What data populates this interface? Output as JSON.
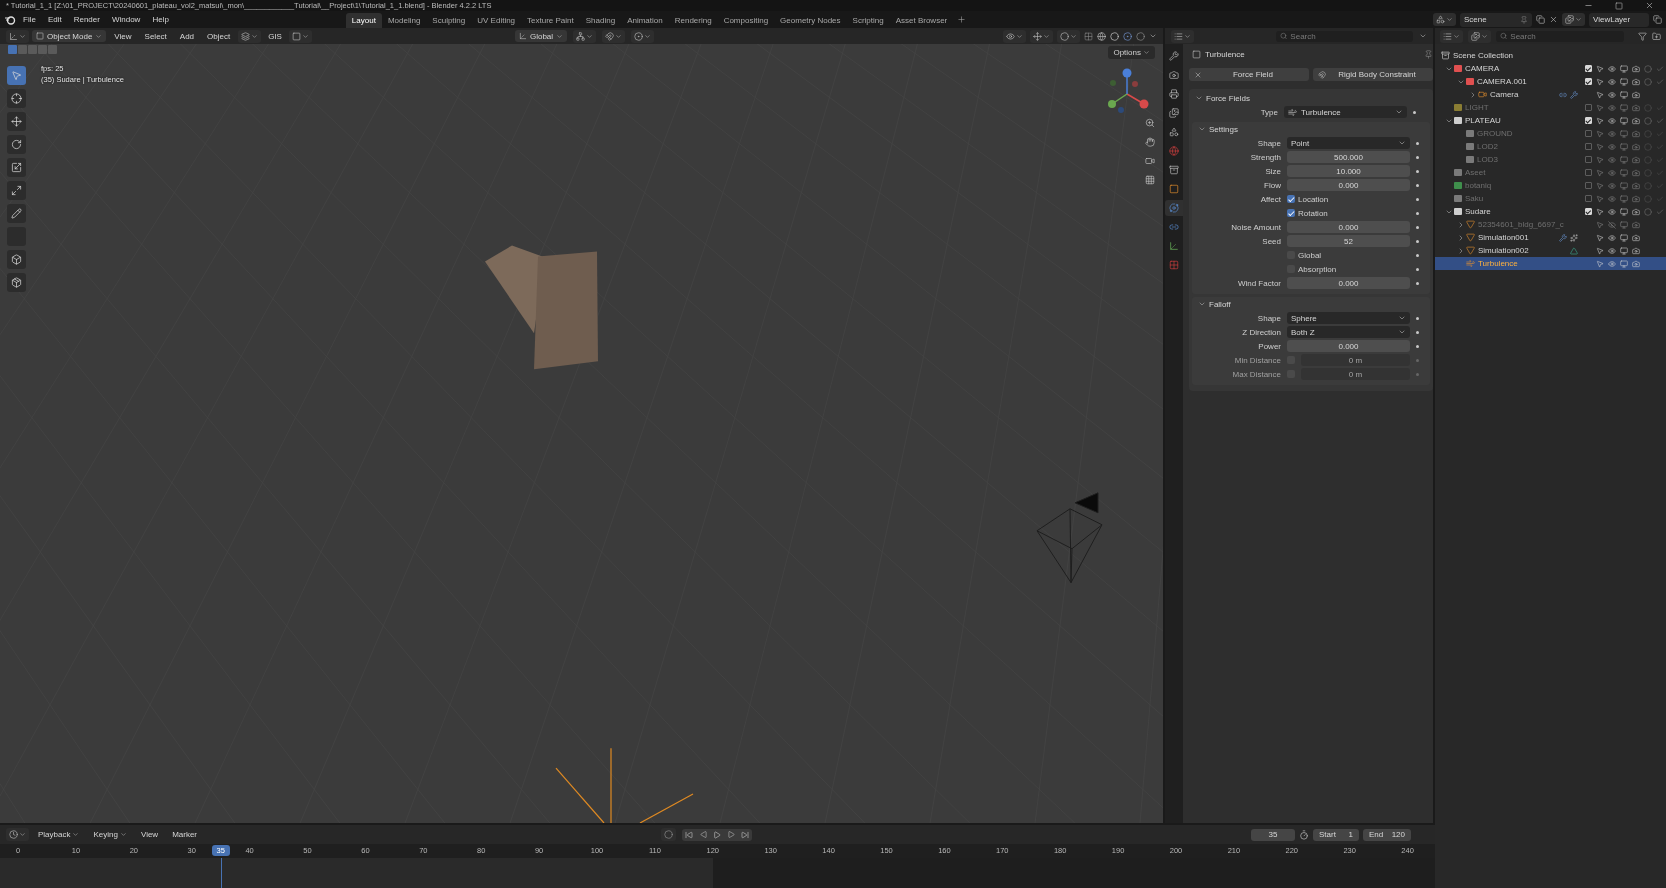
{
  "window": {
    "title": "* Tutorial_1_1 [Z:\\01_PROJECT\\20240601_plateau_vol2_matsui\\_mon\\____________Tutorial\\__Project\\1\\Tutorial_1_1.blend] - Blender 4.2.2 LTS"
  },
  "topbar": {
    "menus": [
      "File",
      "Edit",
      "Render",
      "Window",
      "Help"
    ],
    "workspaces": [
      {
        "label": "Layout",
        "selected": true
      },
      {
        "label": "Modeling",
        "selected": false
      },
      {
        "label": "Sculpting",
        "selected": false
      },
      {
        "label": "UV Editing",
        "selected": false
      },
      {
        "label": "Texture Paint",
        "selected": false
      },
      {
        "label": "Shading",
        "selected": false
      },
      {
        "label": "Animation",
        "selected": false
      },
      {
        "label": "Rendering",
        "selected": false
      },
      {
        "label": "Compositing",
        "selected": false
      },
      {
        "label": "Geometry Nodes",
        "selected": false
      },
      {
        "label": "Scripting",
        "selected": false
      },
      {
        "label": "Asset Browser",
        "selected": false
      }
    ],
    "scene": "Scene",
    "view_layer": "ViewLayer"
  },
  "viewport": {
    "mode": "Object Mode",
    "menus": [
      "View",
      "Select",
      "Add",
      "Object"
    ],
    "addon": "GIS",
    "orientation": "Global",
    "options": "Options",
    "overlay_lines": [
      "fps: 25",
      "(35) Sudare | Turbulence"
    ]
  },
  "properties": {
    "search": {
      "placeholder": "Search"
    },
    "tabs": [
      {
        "kind": "tool",
        "selected": false
      },
      {
        "kind": "render",
        "selected": false
      },
      {
        "kind": "output",
        "selected": false
      },
      {
        "kind": "view_layer",
        "selected": false
      },
      {
        "kind": "scene",
        "selected": false
      },
      {
        "kind": "world",
        "selected": false
      },
      {
        "kind": "collection",
        "selected": false
      },
      {
        "kind": "object",
        "selected": false
      },
      {
        "kind": "physics",
        "selected": true
      },
      {
        "kind": "constraints",
        "selected": false
      },
      {
        "kind": "data",
        "selected": false
      },
      {
        "kind": "texture",
        "selected": false
      }
    ],
    "object": "Turbulence",
    "buttons": [
      {
        "label": "Force Field",
        "kind": "remove"
      },
      {
        "label": "Rigid Body Constraint",
        "kind": "add"
      }
    ],
    "panel": {
      "title": "Force Fields",
      "expanded": true,
      "rows": [
        {
          "kind": "dropdown",
          "label": "Type",
          "value": "Turbulence",
          "with_icon": true
        }
      ],
      "subpanels": [
        {
          "title": "Settings",
          "expanded": true,
          "rows": [
            {
              "kind": "dropdown",
              "label": "Shape",
              "value": "Point",
              "with_icon": false
            },
            {
              "kind": "number",
              "label": "Strength",
              "value": "500.000"
            },
            {
              "kind": "number",
              "label": "Size",
              "value": "10.000"
            },
            {
              "kind": "number",
              "label": "Flow",
              "value": "0.000"
            },
            {
              "kind": "checkbox",
              "label": "Affect",
              "text": "Location",
              "checked": true
            },
            {
              "kind": "checkbox",
              "text": "Rotation",
              "checked": true
            },
            {
              "kind": "number",
              "label": "Noise Amount",
              "value": "0.000"
            },
            {
              "kind": "number",
              "label": "Seed",
              "value": "52"
            },
            {
              "kind": "checkbox",
              "text": "Global",
              "checked": false
            },
            {
              "kind": "checkbox",
              "text": "Absorption",
              "checked": false
            },
            {
              "kind": "number",
              "label": "Wind Factor",
              "value": "0.000"
            }
          ]
        },
        {
          "title": "Falloff",
          "expanded": true,
          "rows": [
            {
              "kind": "dropdown",
              "label": "Shape",
              "value": "Sphere",
              "with_icon": false
            },
            {
              "kind": "dropdown",
              "label": "Z Direction",
              "value": "Both Z",
              "with_icon": false
            },
            {
              "kind": "number",
              "label": "Power",
              "value": "0.000"
            },
            {
              "kind": "toggle_number",
              "label": "Min Distance",
              "checked": false,
              "value": "0 m"
            },
            {
              "kind": "toggle_number",
              "label": "Max Distance",
              "checked": false,
              "value": "0 m"
            }
          ]
        }
      ]
    }
  },
  "outliner": {
    "search": {
      "placeholder": "Search"
    },
    "root": "Scene Collection",
    "items": [
      {
        "kind": "collection",
        "label": "CAMERA",
        "color": "#e05050",
        "checked": true,
        "disabled": false,
        "visible": true,
        "selected": false,
        "expanded": true,
        "children": [
          {
            "kind": "collection",
            "label": "CAMERA.001",
            "color": "#e05050",
            "checked": true,
            "disabled": false,
            "visible": true,
            "selected": false,
            "expanded": true,
            "children": [
              {
                "kind": "camera",
                "label": "Camera",
                "disabled": false,
                "visible": true,
                "selected": false,
                "expanded": false,
                "badges": [
                  {
                    "kind": "constraint"
                  },
                  {
                    "kind": "modifier"
                  }
                ]
              }
            ]
          }
        ]
      },
      {
        "kind": "collection",
        "label": "LIGHT",
        "color": "#8a7d33",
        "checked": false,
        "disabled": true,
        "visible": true,
        "selected": false
      },
      {
        "kind": "collection",
        "label": "PLATEAU",
        "color": "#cfcfcf",
        "checked": true,
        "disabled": false,
        "visible": true,
        "selected": false,
        "expanded": true,
        "children": [
          {
            "kind": "collection",
            "label": "GROUND",
            "color": "#7a7a7a",
            "checked": false,
            "disabled": true,
            "visible": true,
            "selected": false
          },
          {
            "kind": "collection",
            "label": "LOD2",
            "color": "#7a7a7a",
            "checked": false,
            "disabled": true,
            "visible": true,
            "selected": false
          },
          {
            "kind": "collection",
            "label": "LOD3",
            "color": "#7a7a7a",
            "checked": false,
            "disabled": true,
            "visible": true,
            "selected": false
          }
        ]
      },
      {
        "kind": "collection",
        "label": "Aseet",
        "color": "#7a7a7a",
        "checked": false,
        "disabled": true,
        "visible": true,
        "selected": false
      },
      {
        "kind": "collection",
        "label": "botaniq",
        "color": "#3f8f4c",
        "checked": false,
        "disabled": true,
        "visible": true,
        "selected": false
      },
      {
        "kind": "collection",
        "label": "Saku",
        "color": "#7a7a7a",
        "checked": false,
        "disabled": true,
        "visible": true,
        "selected": false
      },
      {
        "kind": "collection",
        "label": "Sudare",
        "color": "#cfcfcf",
        "checked": true,
        "disabled": false,
        "visible": true,
        "selected": false,
        "expanded": true,
        "children": [
          {
            "kind": "mesh",
            "label": "52354601_bldg_6697_c",
            "disabled": true,
            "visible": false,
            "selected": false,
            "expanded": false
          },
          {
            "kind": "mesh",
            "label": "Simulation001",
            "disabled": false,
            "visible": true,
            "selected": false,
            "expanded": false,
            "badges": [
              {
                "kind": "modifier"
              },
              {
                "kind": "particles"
              }
            ]
          },
          {
            "kind": "mesh",
            "label": "Simulation002",
            "disabled": false,
            "visible": true,
            "selected": false,
            "expanded": false,
            "badges": [
              {
                "kind": "vertex_group"
              }
            ]
          },
          {
            "kind": "force_field",
            "label": "Turbulence",
            "disabled": false,
            "visible": true,
            "selected": true
          }
        ]
      }
    ]
  },
  "timeline": {
    "menus": [
      {
        "label": "Playback",
        "dropdown": true
      },
      {
        "label": "Keying",
        "dropdown": true
      },
      {
        "label": "View",
        "dropdown": false
      },
      {
        "label": "Marker",
        "dropdown": false
      }
    ],
    "current_frame": "35",
    "start_label": "Start",
    "start": "1",
    "end_label": "End",
    "end": "120",
    "playhead": "35",
    "ticks": [
      "0",
      "10",
      "20",
      "30",
      "40",
      "50",
      "60",
      "70",
      "80",
      "90",
      "100",
      "110",
      "120",
      "130",
      "140",
      "150",
      "160",
      "170",
      "180",
      "190",
      "200",
      "210",
      "220",
      "230",
      "240"
    ]
  }
}
